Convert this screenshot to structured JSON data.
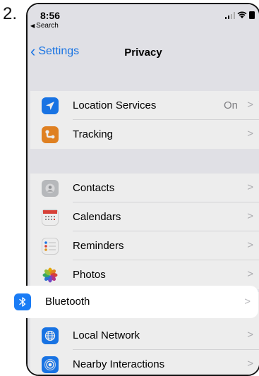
{
  "step_number": "2.",
  "status_bar": {
    "time": "8:56",
    "back_app": "Search"
  },
  "nav": {
    "back_label": "Settings",
    "title": "Privacy"
  },
  "group1": [
    {
      "label": "Location Services",
      "value": "On",
      "icon": "location-arrow-icon",
      "icon_color": "#1a7cf5"
    },
    {
      "label": "Tracking",
      "value": "",
      "icon": "tracking-icon",
      "icon_color": "#f08a24"
    }
  ],
  "group2": [
    {
      "label": "Contacts",
      "icon": "contacts-icon",
      "icon_color": "#b0b3b8"
    },
    {
      "label": "Calendars",
      "icon": "calendar-icon",
      "icon_color": "#ffffff"
    },
    {
      "label": "Reminders",
      "icon": "reminders-icon",
      "icon_color": "#ffffff"
    },
    {
      "label": "Photos",
      "icon": "photos-icon",
      "icon_color": "#ffffff"
    }
  ],
  "highlight": {
    "label": "Bluetooth",
    "icon": "bluetooth-icon",
    "icon_color": "#1a7cf5"
  },
  "group3": [
    {
      "label": "Local Network",
      "icon": "globe-icon",
      "icon_color": "#1a7cf5"
    },
    {
      "label": "Nearby Interactions",
      "icon": "nearby-icon",
      "icon_color": "#1a7cf5"
    }
  ],
  "chevron": ">",
  "colors": {
    "accent": "#1a7cf5",
    "grouped_background": "#f2f2f7"
  }
}
